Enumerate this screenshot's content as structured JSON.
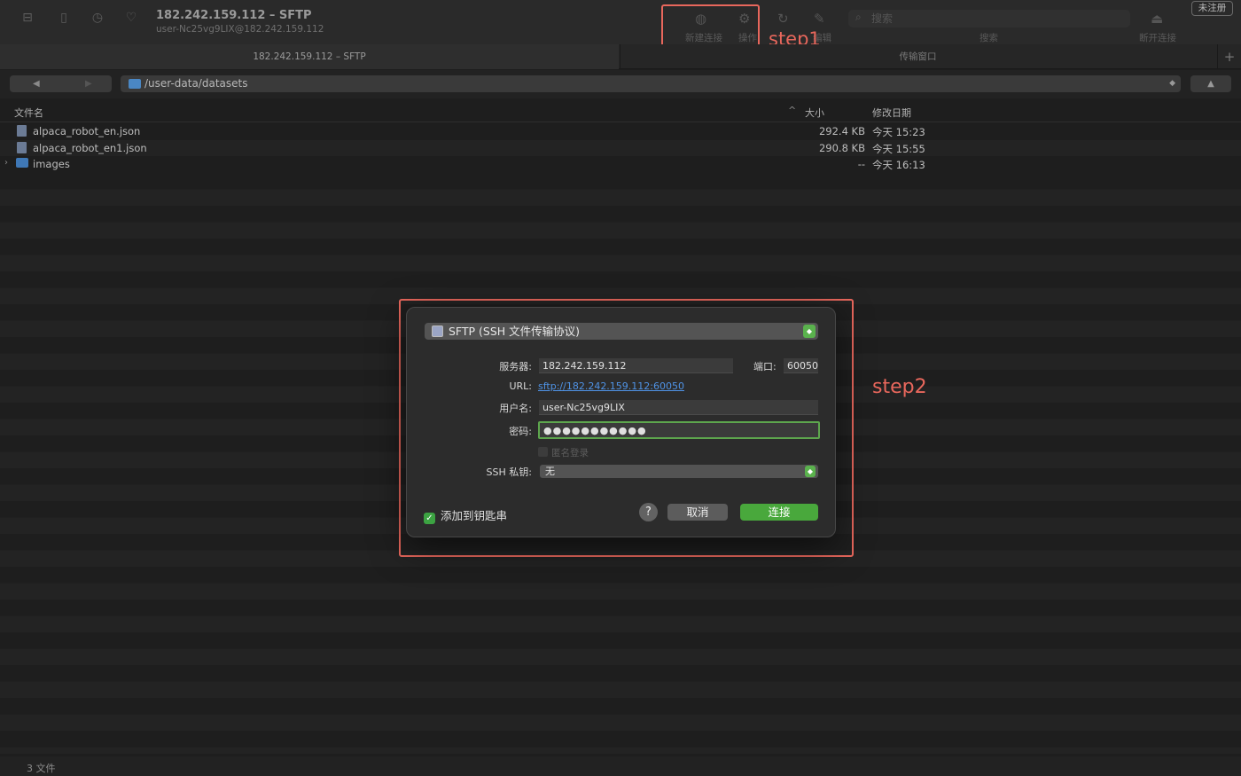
{
  "window": {
    "title": "182.242.159.112 – SFTP",
    "subtitle": "user-Nc25vg9LIX@182.242.159.112",
    "unregistered": "未注册"
  },
  "toolbar": {
    "new_connection": "新建连接",
    "action": "操作",
    "edit": "编辑",
    "search_placeholder": "搜索",
    "search_label": "搜索",
    "disconnect": "断开连接",
    "icons": [
      "sidebar-icon",
      "bonjour-icon",
      "history-icon",
      "bookmark-icon",
      "globe-icon",
      "gear-icon",
      "refresh-icon",
      "pencil-icon",
      "search-icon",
      "eject-icon"
    ]
  },
  "annotations": {
    "step1": "step1",
    "step2": "step2",
    "color": "#e8675c"
  },
  "tabs": [
    {
      "label": "182.242.159.112 – SFTP"
    },
    {
      "label": "传输窗口"
    }
  ],
  "tab_add": "+",
  "path": {
    "back": "◀",
    "forward": "▶",
    "current": "/user-data/datasets",
    "up": "▲"
  },
  "list": {
    "headers": {
      "name": "文件名",
      "size": "大小",
      "modified": "修改日期",
      "sort": "^"
    },
    "rows": [
      {
        "name": "alpaca_robot_en.json",
        "size": "292.4 KB",
        "modified": "今天 15:23",
        "type": "file"
      },
      {
        "name": "alpaca_robot_en1.json",
        "size": "290.8 KB",
        "modified": "今天 15:55",
        "type": "file"
      },
      {
        "name": "images",
        "size": "--",
        "modified": "今天 16:13",
        "type": "folder"
      }
    ]
  },
  "status": {
    "count": "3 文件"
  },
  "dialog": {
    "protocol": "SFTP (SSH 文件传输协议)",
    "server_label": "服务器:",
    "server_value": "182.242.159.112",
    "port_label": "端口:",
    "port_value": "60050",
    "url_label": "URL:",
    "url_value": "sftp://182.242.159.112:60050",
    "username_label": "用户名:",
    "username_value": "user-Nc25vg9LIX",
    "password_label": "密码:",
    "password_value": "●●●●●●●●●●●",
    "anonymous_label": "匿名登录",
    "ssh_key_label": "SSH 私钥:",
    "ssh_key_value": "无",
    "keychain_label": "添加到钥匙串",
    "help": "?",
    "cancel": "取消",
    "connect": "连接"
  },
  "colors": {
    "accent_green": "#49a83c",
    "link_blue": "#4f93e6",
    "annotation_red": "#e8675c"
  }
}
